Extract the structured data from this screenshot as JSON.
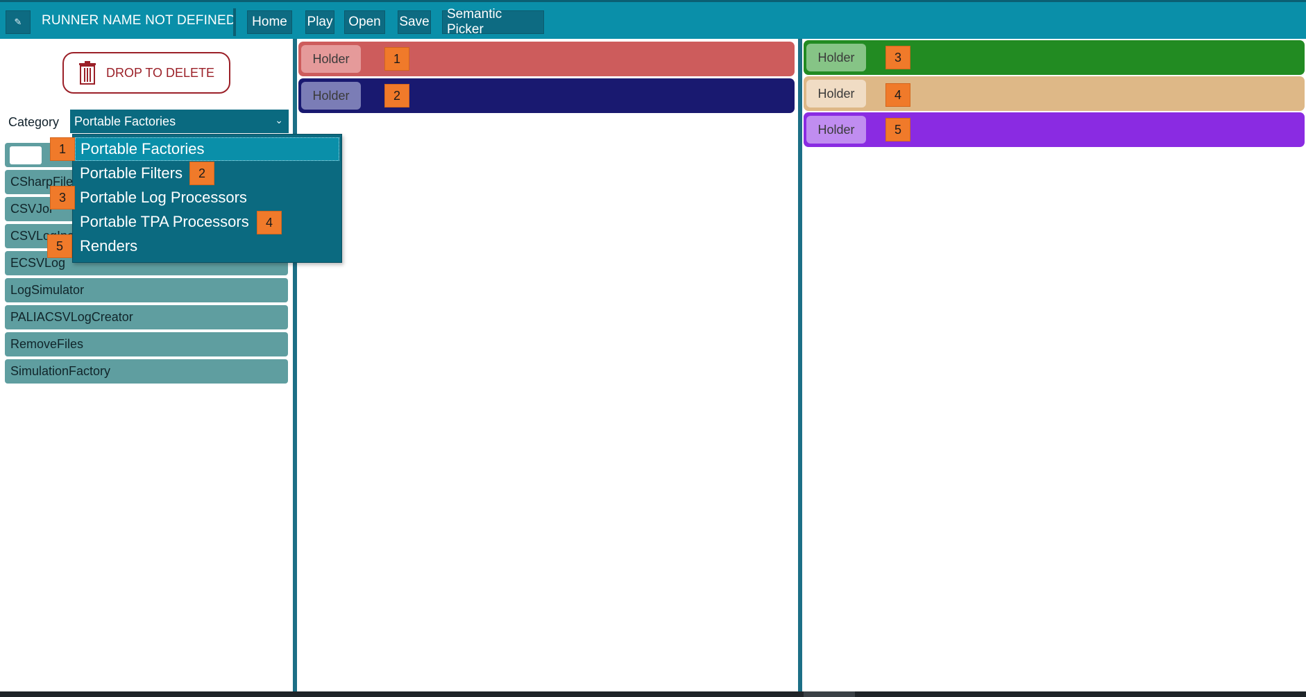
{
  "toolbar": {
    "runner_name": "RUNNER NAME NOT DEFINED",
    "buttons": [
      "Home",
      "Play",
      "Open",
      "Save",
      "Semantic Picker"
    ],
    "edit_icon": "pencil-icon"
  },
  "sidebar": {
    "drop_delete_label": "DROP TO DELETE",
    "category_label": "Category",
    "category_selected": "Portable Factories",
    "components": [
      "",
      "CSharpFile",
      "CSVJoi",
      "CSVLogInc",
      "ECSVLog",
      "LogSimulator",
      "PALIACSVLogCreator",
      "RemoveFiles",
      "SimulationFactory"
    ]
  },
  "category_dropdown": {
    "options": [
      {
        "label": "Portable Factories",
        "badge": "1"
      },
      {
        "label": "Portable Filters",
        "badge": "2"
      },
      {
        "label": "Portable Log Processors",
        "badge": "3"
      },
      {
        "label": "Portable TPA Processors",
        "badge": "4"
      },
      {
        "label": "Renders",
        "badge": "5"
      }
    ]
  },
  "middle_panel": {
    "holders": [
      {
        "label": "Holder",
        "badge": "1",
        "color": "#cd5c5c",
        "pill_color": "#e59a9a"
      },
      {
        "label": "Holder",
        "badge": "2",
        "color": "#191970",
        "pill_color": "#7b7db6"
      }
    ]
  },
  "right_panel": {
    "holders": [
      {
        "label": "Holder",
        "badge": "3",
        "color": "#228b22",
        "pill_color": "#86c486"
      },
      {
        "label": "Holder",
        "badge": "4",
        "color": "#deb887",
        "pill_color": "#f0dcc4"
      },
      {
        "label": "Holder",
        "badge": "5",
        "color": "#8a2be2",
        "pill_color": "#c08df0"
      }
    ]
  }
}
